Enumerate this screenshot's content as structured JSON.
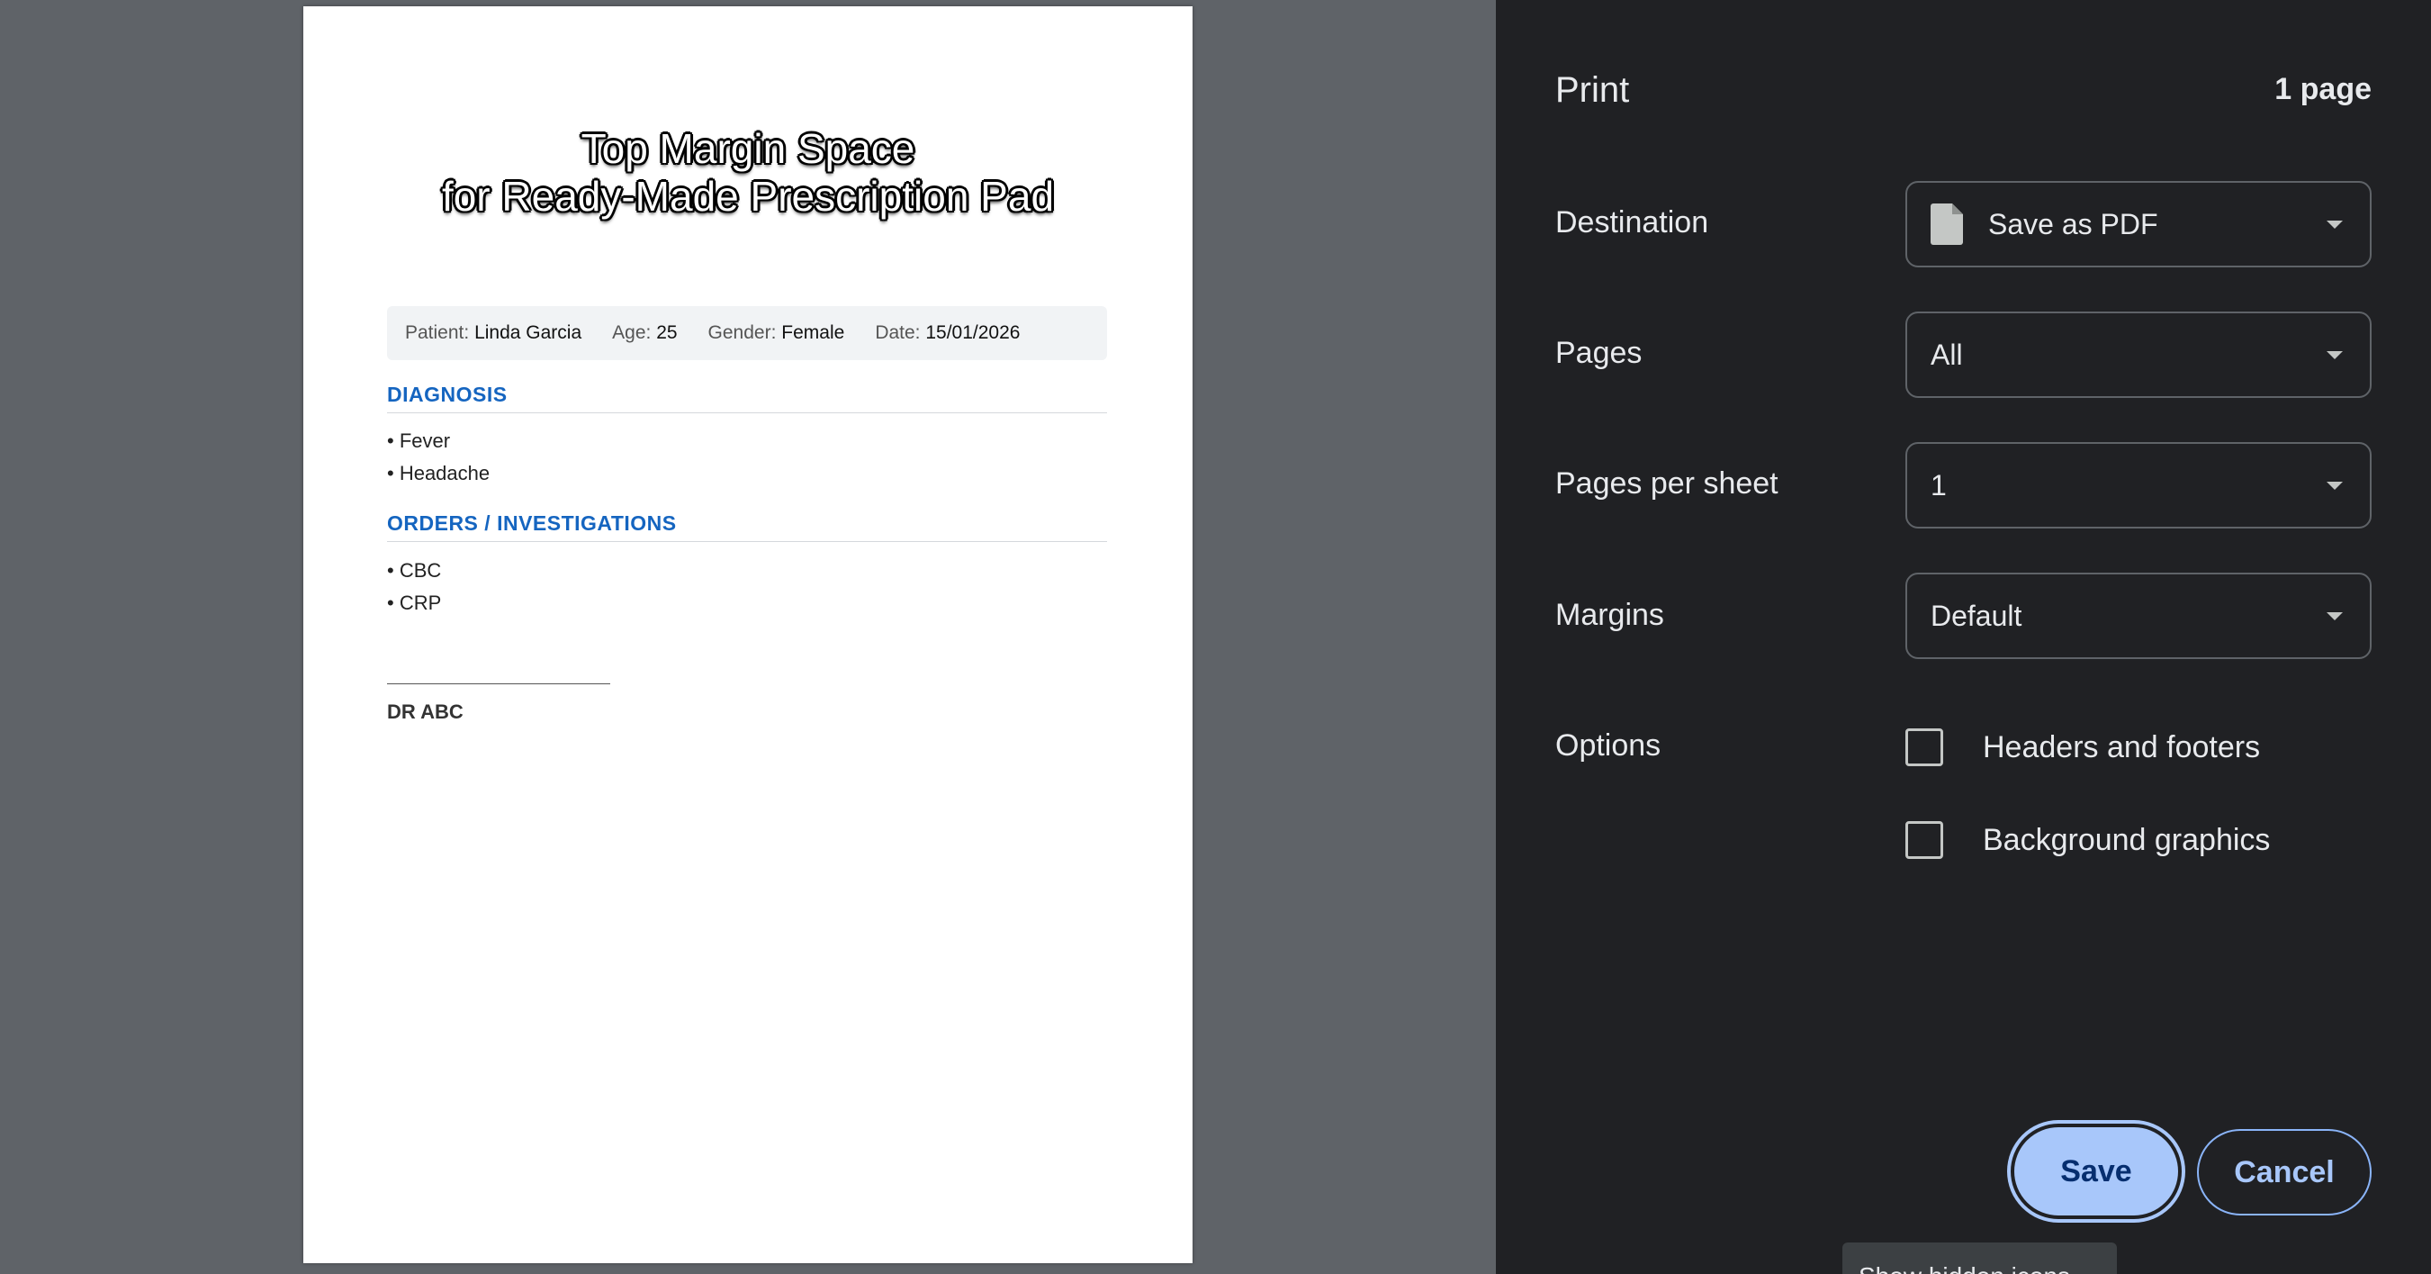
{
  "preview": {
    "top_note_line1": "Top Margin Space",
    "top_note_line2": "for Ready-Made Prescription Pad",
    "patient": {
      "patient_label": "Patient:",
      "patient_value": "Linda Garcia",
      "age_label": "Age:",
      "age_value": "25",
      "gender_label": "Gender:",
      "gender_value": "Female",
      "date_label": "Date:",
      "date_value": "15/01/2026"
    },
    "diagnosis_title": "DIAGNOSIS",
    "diagnosis_items": [
      "• Fever",
      "• Headache"
    ],
    "orders_title": "ORDERS / INVESTIGATIONS",
    "orders_items": [
      "• CBC",
      "• CRP"
    ],
    "doctor_name": "DR ABC"
  },
  "panel": {
    "title": "Print",
    "page_count": "1 page",
    "destination": {
      "label": "Destination",
      "value": "Save as PDF"
    },
    "pages": {
      "label": "Pages",
      "value": "All"
    },
    "pages_per_sheet": {
      "label": "Pages per sheet",
      "value": "1"
    },
    "margins": {
      "label": "Margins",
      "value": "Default"
    },
    "options": {
      "label": "Options",
      "headers_footers": "Headers and footers",
      "background_graphics": "Background graphics"
    },
    "save_label": "Save",
    "cancel_label": "Cancel",
    "tooltip": "Show hidden icons"
  },
  "icons": {
    "destination": "document-icon",
    "dropdown": "caret-down-icon"
  },
  "colors": {
    "accent": "#a8c7fa",
    "panel_bg": "#202124",
    "section_title": "#1565c0",
    "preview_bg": "#5f6368"
  }
}
